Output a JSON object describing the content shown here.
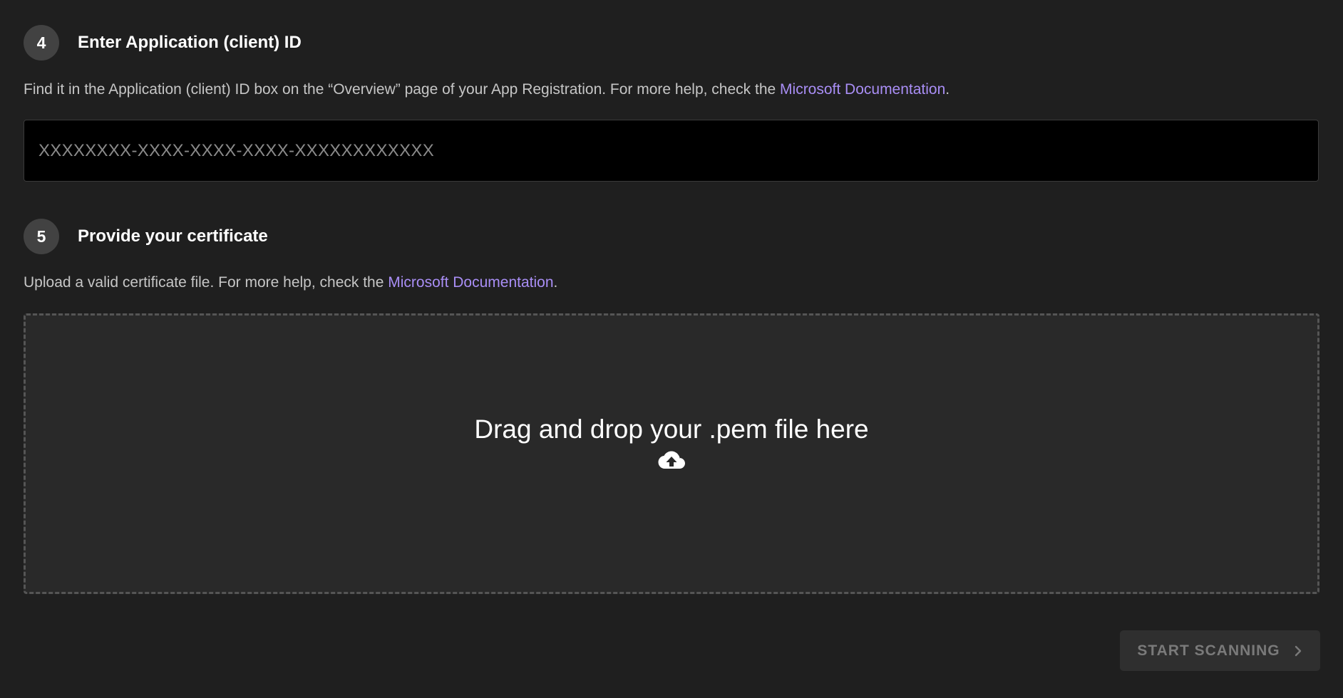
{
  "step4": {
    "number": "4",
    "title": "Enter Application (client) ID",
    "description_prefix": "Find it in the Application (client) ID box on the “Overview” page of your App Registration. For more help, check the ",
    "link_text": "Microsoft Documentation",
    "description_suffix": ".",
    "input_placeholder": "XXXXXXXX-XXXX-XXXX-XXXX-XXXXXXXXXXXX",
    "input_value": ""
  },
  "step5": {
    "number": "5",
    "title": "Provide your certificate",
    "description_prefix": "Upload a valid certificate file. For more help, check the ",
    "link_text": "Microsoft Documentation",
    "description_suffix": ".",
    "dropzone_text": "Drag and drop your .pem file here",
    "dropzone_icon": "cloud-upload-icon"
  },
  "footer": {
    "start_button_label": "START SCANNING",
    "start_button_icon": "chevron-right-icon",
    "start_button_disabled": true
  },
  "colors": {
    "background": "#1f1f1f",
    "badge": "#424242",
    "link": "#a98ef5",
    "input_bg": "#000000",
    "dropzone_bg": "#292929",
    "button_bg": "#2f2f2f",
    "button_text_disabled": "#7a7a7a"
  }
}
